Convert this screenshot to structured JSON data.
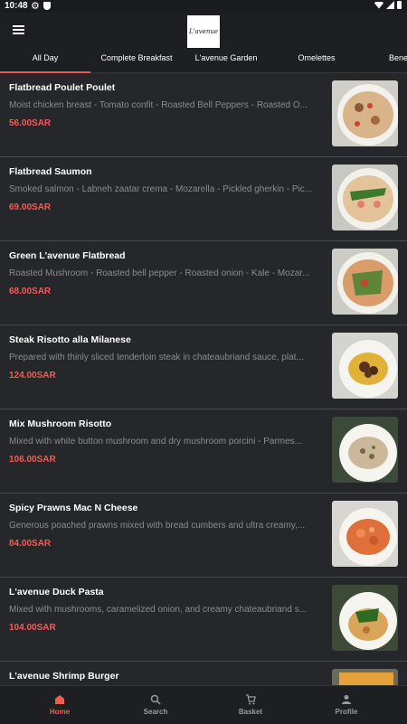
{
  "status": {
    "time": "10:48"
  },
  "logo": {
    "text": "L'avenue"
  },
  "tabs": [
    {
      "label": "All Day"
    },
    {
      "label": "Complete Breakfast"
    },
    {
      "label": "L'avenue Garden"
    },
    {
      "label": "Omelettes"
    },
    {
      "label": "Bene"
    }
  ],
  "items": [
    {
      "name": "Flatbread Poulet Poulet",
      "desc": "Moist chicken breast - Tomato confit - Roasted Bell Peppers - Roasted O...",
      "price": "56.00SAR"
    },
    {
      "name": "Flatbread Saumon",
      "desc": "Smoked salmon - Labneh zaatar crema - Mozarella - Pickled gherkin - Pic...",
      "price": "69.00SAR"
    },
    {
      "name": "Green L'avenue Flatbread",
      "desc": "Roasted Mushroom - Roasted bell pepper - Roasted onion - Kale - Mozar...",
      "price": "68.00SAR"
    },
    {
      "name": "Steak Risotto alla Milanese",
      "desc": "Prepared with thinly sliced tenderloin steak in chateaubriand sauce, plat...",
      "price": "124.00SAR"
    },
    {
      "name": "Mix Mushroom Risotto",
      "desc": "Mixed with white button mushroom and dry mushroom porcini - Parmes...",
      "price": "106.00SAR"
    },
    {
      "name": "Spicy Prawns Mac N Cheese",
      "desc": "Generous poached prawns mixed with bread cumbers and ultra creamy,...",
      "price": "84.00SAR"
    },
    {
      "name": "L'avenue Duck Pasta",
      "desc": "Mixed with mushrooms, caramelized onion, and creamy chateaubriand s...",
      "price": "104.00SAR"
    },
    {
      "name": "L'avenue Shrimp Burger",
      "desc": "",
      "price": ""
    }
  ],
  "nav": [
    {
      "label": "Home"
    },
    {
      "label": "Search"
    },
    {
      "label": "Basket"
    },
    {
      "label": "Profile"
    }
  ]
}
